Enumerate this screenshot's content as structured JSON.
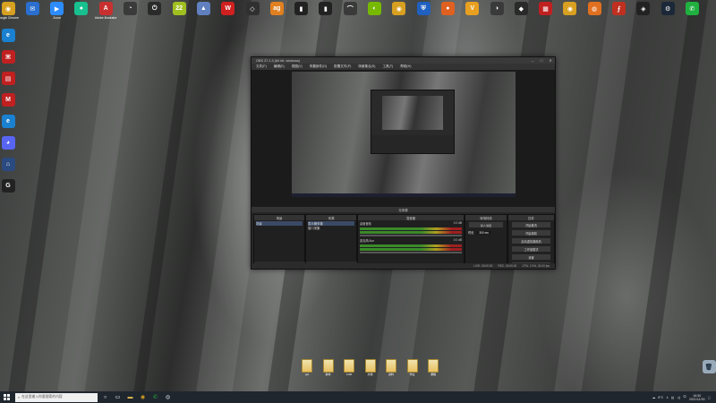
{
  "top_icons": [
    {
      "label": "Google Chrome",
      "icon": "chrome-icon",
      "color": "#d8a020",
      "glyph": "◉"
    },
    {
      "label": "",
      "icon": "app-icon",
      "color": "#2a6fd0",
      "glyph": "✉"
    },
    {
      "label": "Zoom",
      "icon": "zoom-icon",
      "color": "#2d8cff",
      "glyph": "▶"
    },
    {
      "label": "",
      "icon": "circle-app-icon",
      "color": "#18c090",
      "glyph": "●"
    },
    {
      "label": "Adobe Illustrator",
      "icon": "illustrator-icon",
      "color": "#c83030",
      "glyph": "A"
    },
    {
      "label": "",
      "icon": "clock-icon",
      "color": "#3a3a3a",
      "glyph": "◔"
    },
    {
      "label": "",
      "icon": "power-icon",
      "color": "#2a2a2a",
      "glyph": "⏻"
    },
    {
      "label": "",
      "icon": "22-icon",
      "color": "#a0c020",
      "glyph": "22"
    },
    {
      "label": "",
      "icon": "mountain-icon",
      "color": "#6080c0",
      "glyph": "▲"
    },
    {
      "label": "",
      "icon": "wps-icon",
      "color": "#d02020",
      "glyph": "W"
    },
    {
      "label": "",
      "icon": "shield-icon",
      "color": "#303030",
      "glyph": "◇"
    },
    {
      "label": "",
      "icon": "ag-icon",
      "color": "#e08020",
      "glyph": "ag"
    },
    {
      "label": "",
      "icon": "bar-chart-icon",
      "color": "#222",
      "glyph": "▮"
    },
    {
      "label": "",
      "icon": "bar-chart-icon",
      "color": "#222",
      "glyph": "▮"
    },
    {
      "label": "",
      "icon": "lasso-icon",
      "color": "#3a3a3a",
      "glyph": "⌒"
    },
    {
      "label": "",
      "icon": "nvidia-icon",
      "color": "#76b900",
      "glyph": "◐"
    },
    {
      "label": "",
      "icon": "chrome-icon",
      "color": "#d8a020",
      "glyph": "◉"
    },
    {
      "label": "",
      "icon": "shield-blue-icon",
      "color": "#2060c0",
      "glyph": "⛨"
    },
    {
      "label": "",
      "icon": "orange-icon",
      "color": "#e06020",
      "glyph": "●"
    },
    {
      "label": "",
      "icon": "v-icon",
      "color": "#e8a020",
      "glyph": "V"
    },
    {
      "label": "",
      "icon": "gauge-icon",
      "color": "#3a3a3a",
      "glyph": "◑"
    },
    {
      "label": "",
      "icon": "cube-icon",
      "color": "#2a2a2a",
      "glyph": "◆"
    },
    {
      "label": "",
      "icon": "grid-icon",
      "color": "#c02020",
      "glyph": "▦"
    },
    {
      "label": "",
      "icon": "chrome-icon",
      "color": "#d8a020",
      "glyph": "◉"
    },
    {
      "label": "",
      "icon": "fox-icon",
      "color": "#e07020",
      "glyph": "◍"
    },
    {
      "label": "",
      "icon": "a-icon",
      "color": "#c03020",
      "glyph": "⨍"
    },
    {
      "label": "",
      "icon": "game-icon",
      "color": "#222",
      "glyph": "◈"
    },
    {
      "label": "",
      "icon": "steam-icon",
      "color": "#1b2838",
      "glyph": "⚙"
    },
    {
      "label": "",
      "icon": "wechat-icon",
      "color": "#20b040",
      "glyph": "✆"
    }
  ],
  "left_icons": [
    {
      "label": "",
      "icon": "edge-icon",
      "color": "#1a80d0",
      "glyph": "e"
    },
    {
      "label": "",
      "icon": "pdf-icon",
      "color": "#c02020",
      "glyph": "⌘"
    },
    {
      "label": "",
      "icon": "print-icon",
      "color": "#c02020",
      "glyph": "▤"
    },
    {
      "label": "",
      "icon": "mcafee-icon",
      "color": "#c02020",
      "glyph": "M"
    },
    {
      "label": "",
      "icon": "edge-icon",
      "color": "#1a80d0",
      "glyph": "e"
    },
    {
      "label": "",
      "icon": "discord-icon",
      "color": "#5865f2",
      "glyph": "◕"
    },
    {
      "label": "",
      "icon": "network-icon",
      "color": "#2a4a80",
      "glyph": "⌂"
    },
    {
      "label": "",
      "icon": "g-icon",
      "color": "#222",
      "glyph": "G"
    }
  ],
  "obs": {
    "title": "OBS 27.1.3 (64 bit, windows)",
    "menu": [
      "文件(F)",
      "编辑(E)",
      "视图(V)",
      "停靠部件(D)",
      "配置文件(P)",
      "场景集合(S)",
      "工具(T)",
      "帮助(H)"
    ],
    "docks_header": "无来源",
    "scenes_title": "场景",
    "scenes": [
      "场景"
    ],
    "sources_title": "来源",
    "sources": [
      "显示器采集",
      "窗口采集"
    ],
    "mixer_title": "混音器",
    "mixer": [
      {
        "name": "桌面音频",
        "level": "0.0 dB"
      },
      {
        "name": "麦克风/Aux",
        "level": "0.0 dB"
      }
    ],
    "transitions_title": "转场特效",
    "transition_value": "淡入淡出",
    "duration_label": "时长",
    "duration_value": "300 ms",
    "controls_title": "控件",
    "controls": [
      "开始推流",
      "开始录制",
      "启动虚拟摄像机",
      "工作室模式",
      "设置",
      "退出"
    ],
    "status": [
      "LIVE: 00:00:00",
      "REC: 00:00:00",
      "CPU: 2.3%, 30.00 fps"
    ]
  },
  "files": [
    {
      "label": "ppt"
    },
    {
      "label": "素材"
    },
    {
      "label": "1130"
    },
    {
      "label": "文档"
    },
    {
      "label": "资料"
    },
    {
      "label": "作业"
    },
    {
      "label": "课程"
    }
  ],
  "taskbar": {
    "search_placeholder": "在这里输入你要搜索的内容",
    "temperature": "8°C",
    "time": "16:50",
    "date": "2021/11/30",
    "lang": "中"
  }
}
